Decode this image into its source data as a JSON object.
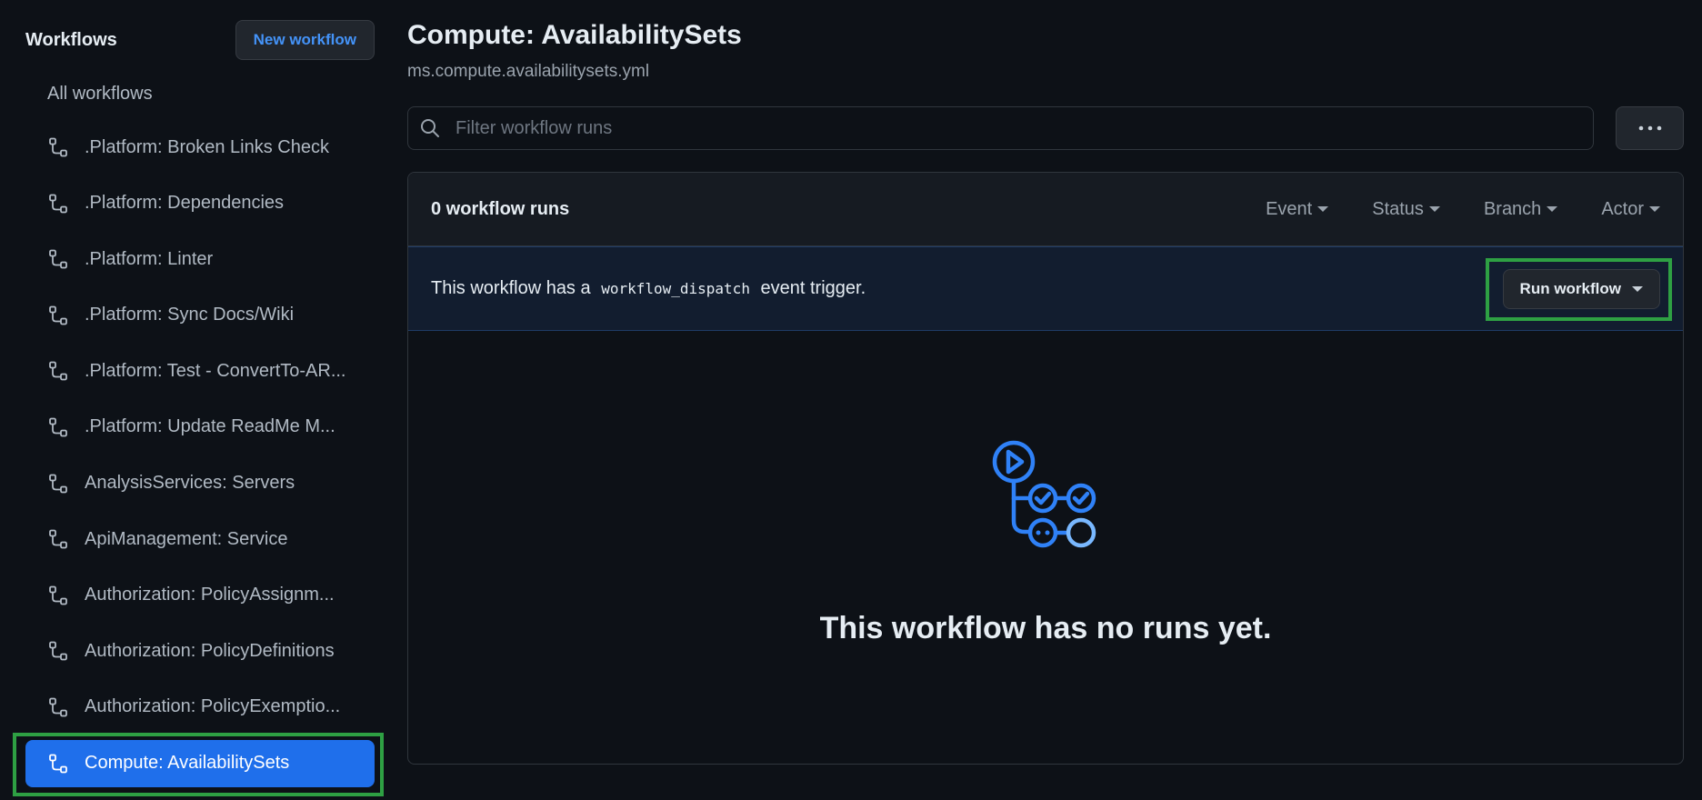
{
  "sidebar": {
    "title": "Workflows",
    "new_workflow_label": "New workflow",
    "all_workflows_label": "All workflows",
    "items": [
      {
        "label": ".Platform: Broken Links Check"
      },
      {
        "label": ".Platform: Dependencies"
      },
      {
        "label": ".Platform: Linter"
      },
      {
        "label": ".Platform: Sync Docs/Wiki"
      },
      {
        "label": ".Platform: Test - ConvertTo-AR..."
      },
      {
        "label": ".Platform: Update ReadMe M..."
      },
      {
        "label": "AnalysisServices: Servers"
      },
      {
        "label": "ApiManagement: Service"
      },
      {
        "label": "Authorization: PolicyAssignm..."
      },
      {
        "label": "Authorization: PolicyDefinitions"
      },
      {
        "label": "Authorization: PolicyExemptio..."
      },
      {
        "label": "Compute: AvailabilitySets",
        "active": true
      }
    ],
    "item_icon": "workflow-icon"
  },
  "main": {
    "title": "Compute: AvailabilitySets",
    "filename": "ms.compute.availabilitysets.yml",
    "filter": {
      "placeholder": "Filter workflow runs",
      "value": ""
    },
    "more_icon": "kebab-horizontal-icon",
    "runs": {
      "count_label": "0 workflow runs",
      "filters": [
        "Event",
        "Status",
        "Branch",
        "Actor"
      ]
    },
    "dispatch": {
      "text_before": "This workflow has a",
      "code": "workflow_dispatch",
      "text_after": "event trigger.",
      "button_label": "Run workflow"
    },
    "empty": {
      "message": "This workflow has no runs yet.",
      "icon": "workflow-runs-illustration"
    }
  },
  "colors": {
    "background": "#0d1117",
    "accent": "#1f6feb",
    "link": "#4493f8",
    "highlight": "#2ea043"
  }
}
